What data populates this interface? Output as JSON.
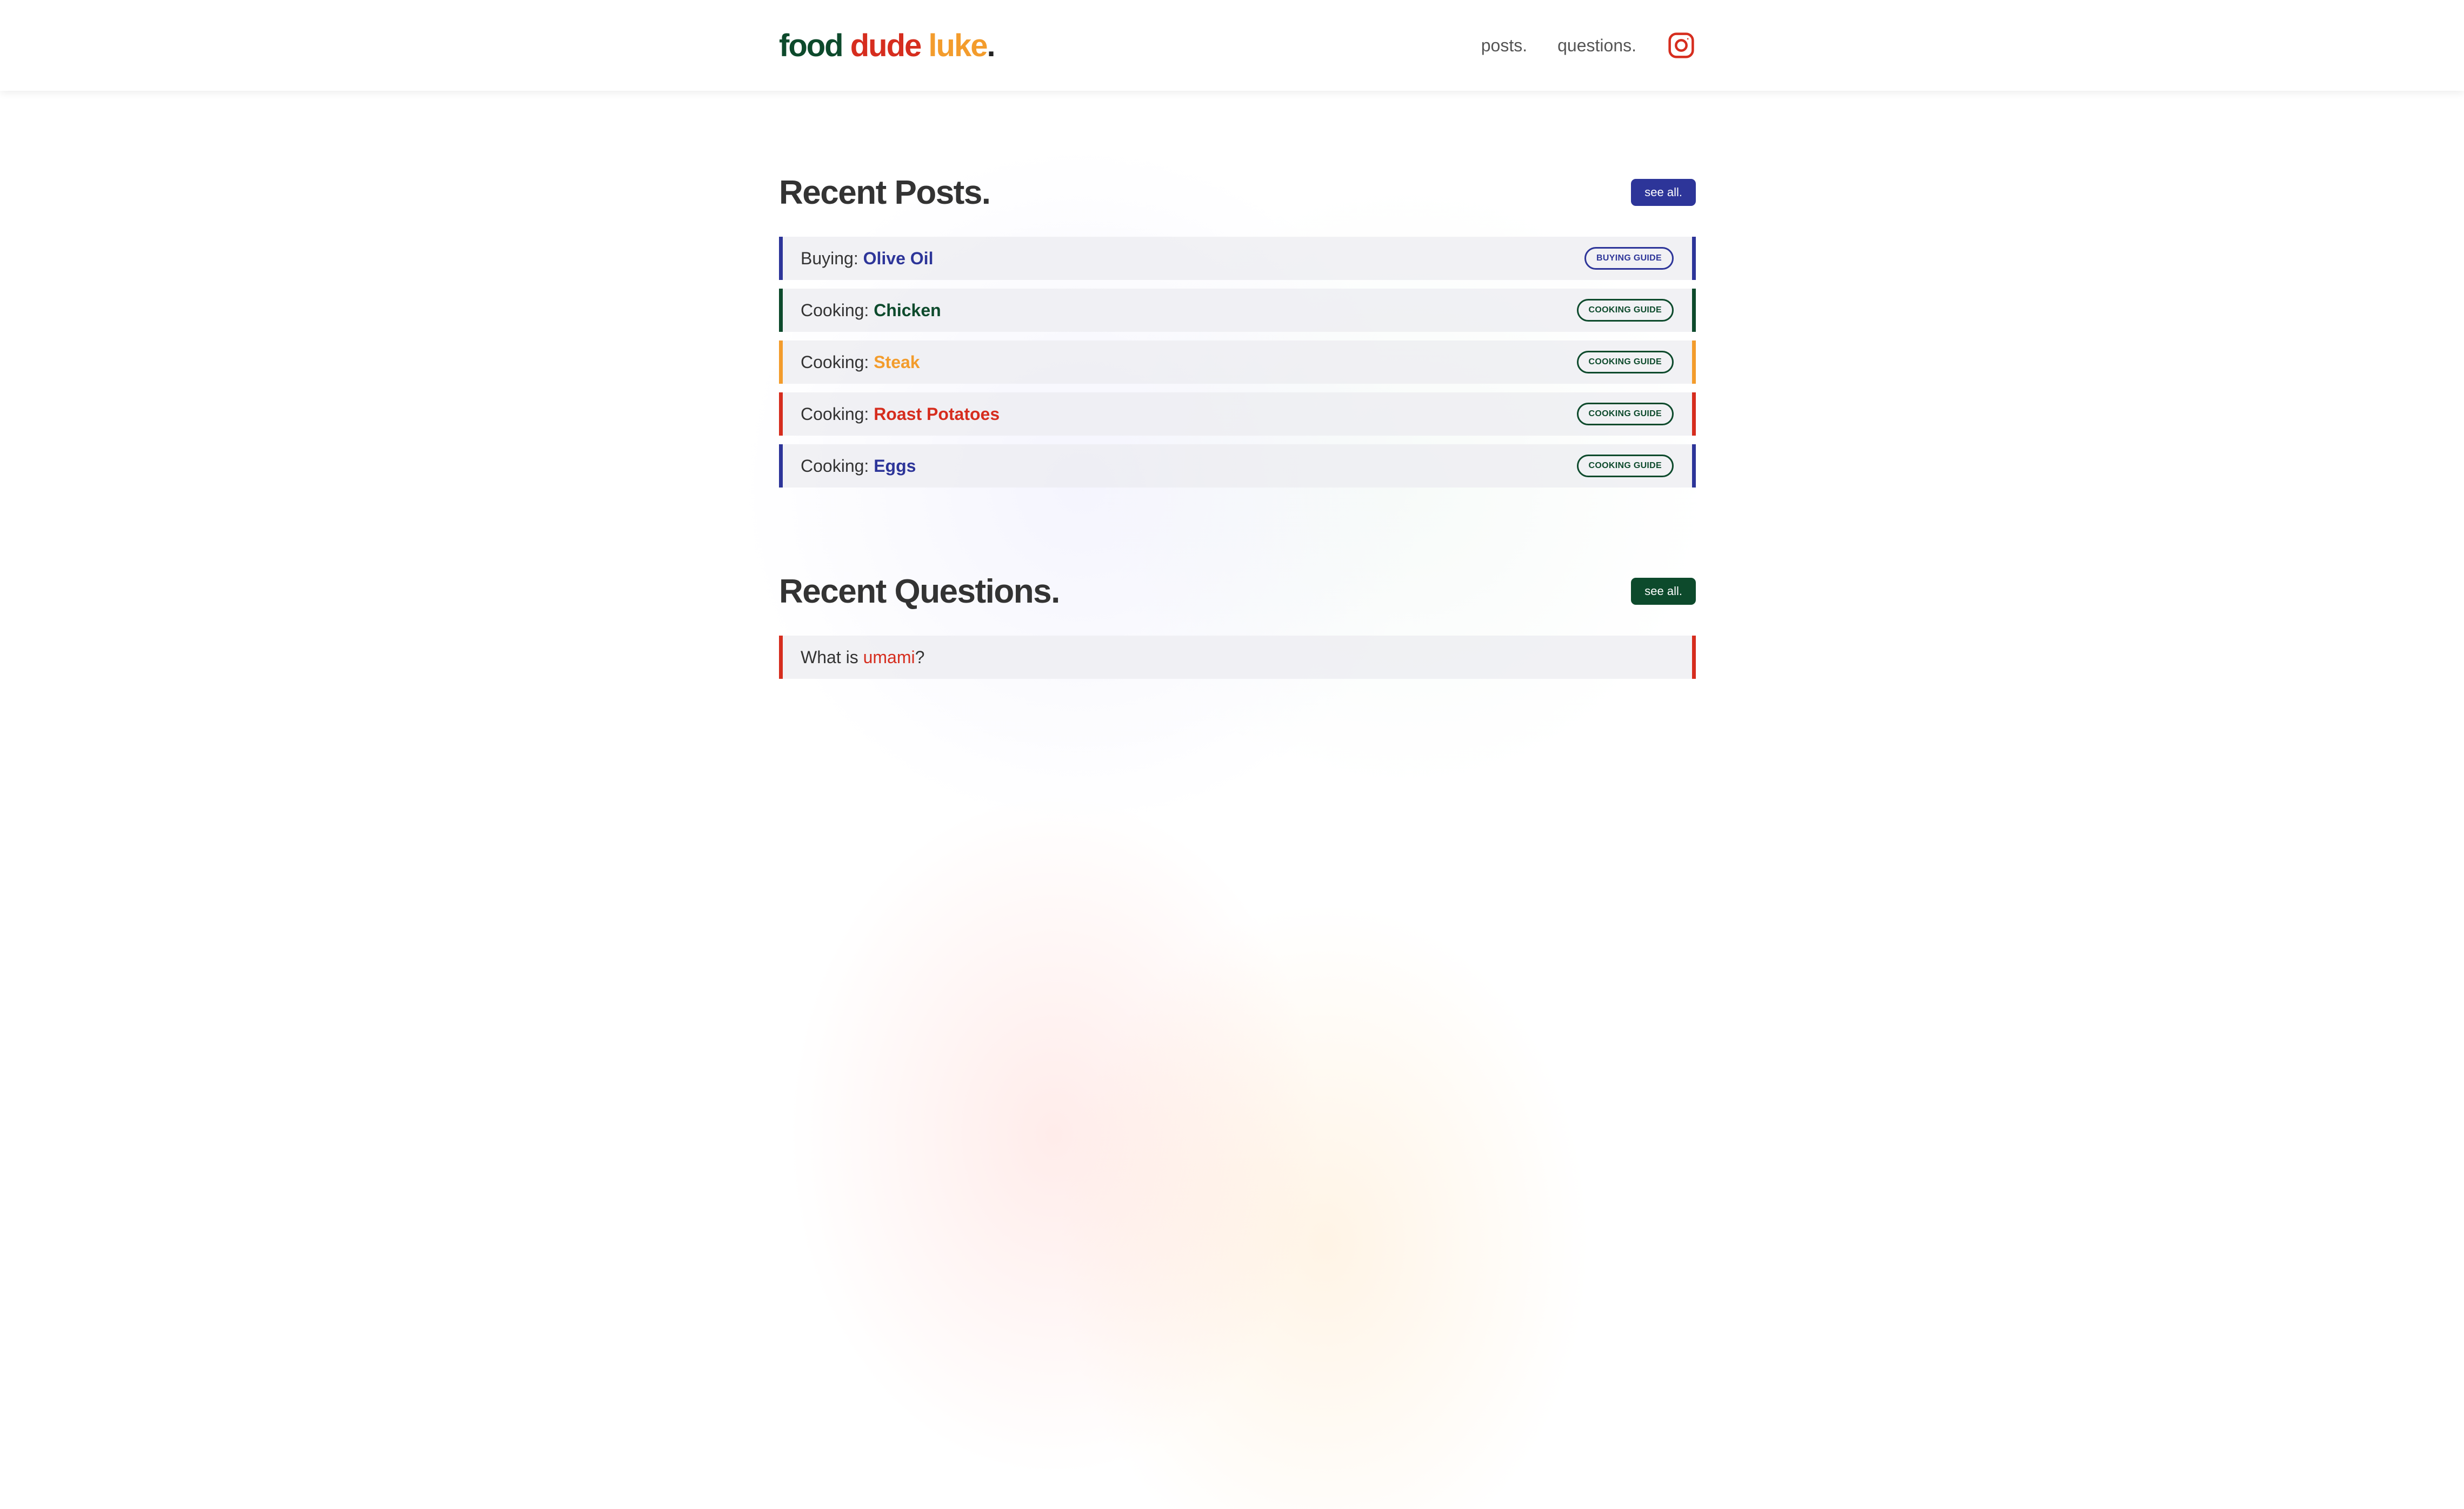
{
  "colors": {
    "blue": "#2d3599",
    "green": "#0d4a2c",
    "orange": "#f39c2c",
    "red": "#d62d1e"
  },
  "header": {
    "logo": {
      "w1": "food",
      "w2": "dude",
      "w3": "luke",
      "dot": "."
    },
    "nav": [
      {
        "label": "posts."
      },
      {
        "label": "questions."
      }
    ],
    "social_icon": "instagram-icon"
  },
  "posts": {
    "title": "Recent Posts.",
    "see_all": "see all.",
    "items": [
      {
        "prefix": "Buying: ",
        "highlight": "Olive Oil",
        "tag": "BUYING GUIDE",
        "accent": "#2d3599",
        "tag_color": "#2d3599"
      },
      {
        "prefix": "Cooking: ",
        "highlight": "Chicken",
        "tag": "COOKING GUIDE",
        "accent": "#0d4a2c",
        "tag_color": "#0d4a2c"
      },
      {
        "prefix": "Cooking: ",
        "highlight": "Steak",
        "tag": "COOKING GUIDE",
        "accent": "#f39c2c",
        "tag_color": "#0d4a2c"
      },
      {
        "prefix": "Cooking: ",
        "highlight": "Roast Potatoes",
        "tag": "COOKING GUIDE",
        "accent": "#d62d1e",
        "tag_color": "#0d4a2c"
      },
      {
        "prefix": "Cooking: ",
        "highlight": "Eggs",
        "tag": "COOKING GUIDE",
        "accent": "#2d3599",
        "tag_color": "#0d4a2c"
      }
    ]
  },
  "questions": {
    "title": "Recent Questions.",
    "see_all": "see all.",
    "items": [
      {
        "prefix": "What is ",
        "highlight": "umami",
        "suffix": "?",
        "accent": "#d62d1e"
      }
    ]
  }
}
